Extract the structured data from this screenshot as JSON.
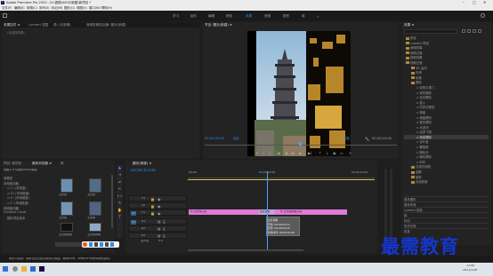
{
  "app": {
    "title": "Adobe Premiere Pro 2020 - D:\\视频\\0000\\新建\\新项目 *",
    "min": "–",
    "max": "□",
    "close": "✕"
  },
  "menu": [
    "文件(F)",
    "编辑(E)",
    "剪辑(C)",
    "序列(S)",
    "标记(M)",
    "图形(G)",
    "视图(V)",
    "窗口(W)",
    "帮助(H)"
  ],
  "workspaces": [
    "学习",
    "组件",
    "编辑",
    "颜色",
    "效果",
    "音频",
    "图形",
    "库"
  ],
  "workspace_active": 4,
  "source_tabs": [
    "效果控件 ≡",
    "Lumetri 范围",
    "源: (无剪辑)",
    "音频剪辑混合器: 圆光(新建)"
  ],
  "source_empty": "(未选择剪辑)",
  "program": {
    "tab": "节目: 圆光(新建) ≡",
    "timecode": "00;00;00;00",
    "fit": "适合",
    "quality": "完整",
    "duration": "00;00;10;00"
  },
  "project": {
    "tabs": [
      "项目: 新项目",
      "媒体浏览器 ≡",
      "库"
    ],
    "path": "电脑 ▸ D:\\视频\\0000\\新建",
    "tree": [
      "收藏夹",
      "本地驱动器",
      "C: (系统盘)",
      "D: (本地磁盘)",
      "E: (本地磁盘)",
      "F: (本地磁盘)",
      "网络驱动器",
      "Creative Cloud",
      "团队项目版本"
    ],
    "thumbs": [
      {
        "label": "五光塔"
      },
      {
        "label": "五光塔"
      },
      {
        "label": "五光塔"
      },
      {
        "label": "五光塔"
      },
      {
        "label": "五光塔剪辑"
      },
      {
        "label": "五光塔剪辑"
      }
    ],
    "bottom_thumb": "五光塔剪辑"
  },
  "timeline": {
    "tab": "圆光(新建) ≡",
    "timecode": "00;00;03;00",
    "ruler": [
      "00;00",
      "00;00;05;00",
      "00;00;10;00"
    ],
    "tracks": [
      "V3",
      "V2",
      "V1",
      "A1",
      "A2",
      "A3"
    ],
    "master": "主声道",
    "master_val": "0.0",
    "clip1": "fx 五光塔.jpg",
    "clip2": "fx 五光塔剪辑.jpg",
    "transition": "交叉溶解",
    "tooltip": [
      "交叉溶解",
      "开始: 00;00;04;12",
      "结束: 00;00;05;18",
      "持续时间: 00;00;01;06"
    ]
  },
  "effects": {
    "tab": "效果 ≡",
    "items": [
      "预设",
      "Lumetri 预设",
      "音频效果",
      "音频过渡",
      "视频效果",
      "视频过渡",
      "3D 运动",
      "内滑",
      "划像",
      "擦除",
      "双侧平推门",
      "带状擦除",
      "径向擦除",
      "插入",
      "时钟式擦除",
      "棋盘",
      "棋盘擦除",
      "楔形擦除",
      "水波块",
      "油漆飞溅",
      "渐变擦除",
      "百叶窗",
      "螺旋框",
      "随机块",
      "随机擦除",
      "风车",
      "沉浸式视频",
      "溶解",
      "缩放",
      "页面剥落"
    ],
    "selected": "渐变擦除",
    "bottom": [
      "基本图形",
      "基本声音",
      "Lumetri 颜色",
      "库",
      "标记",
      "历史记录",
      "信息"
    ]
  },
  "statusbar": "单击以选择，或单击空白处并拖动以框选。使用Shift、Alt和Ctrl可获得其他选项。",
  "taskbar": {
    "time": "11:50",
    "date": "2021/11/8"
  },
  "watermark": "最需教育",
  "colors": {
    "accent": "#2d8ceb",
    "clip": "#e07ad8",
    "playhead": "#4ca0ff"
  }
}
